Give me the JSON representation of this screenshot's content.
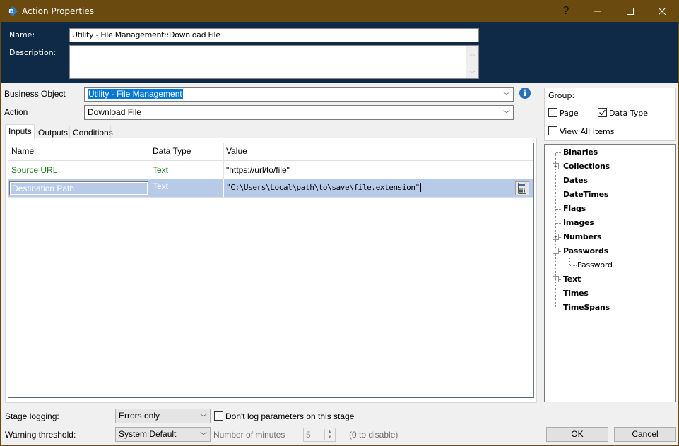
{
  "window": {
    "title": "Action Properties",
    "help_glyph": "?",
    "minimize_glyph": "—",
    "maximize_glyph": "☐",
    "close_glyph": "✕",
    "icon": "blueprism-app-icon"
  },
  "header": {
    "name_label": "Name:",
    "name_value": "Utility - File Management::Download File",
    "description_label": "Description:",
    "description_value": ""
  },
  "form": {
    "business_object_label": "Business Object",
    "business_object_value": "Utility - File Management",
    "action_label": "Action",
    "action_value": "Download File"
  },
  "tabs": [
    {
      "label": "Inputs",
      "active": true
    },
    {
      "label": "Outputs",
      "active": false
    },
    {
      "label": "Conditions",
      "active": false
    }
  ],
  "inputs_grid": {
    "columns": [
      "Name",
      "Data Type",
      "Value"
    ],
    "rows": [
      {
        "name": "Source URL",
        "data_type": "Text",
        "value": "\"https://url/to/file\"",
        "selected": false
      },
      {
        "name": "Destination Path",
        "data_type": "Text",
        "value": "\"C:\\Users\\Local\\path\\to\\save\\file.extension\"",
        "selected": true
      }
    ]
  },
  "group": {
    "label": "Group:",
    "page_label": "Page",
    "page_checked": false,
    "data_type_label": "Data Type",
    "data_type_checked": true,
    "view_all_label": "View All Items",
    "view_all_checked": false
  },
  "tree": {
    "items": [
      {
        "label": "Binaries",
        "expander": ""
      },
      {
        "label": "Collections",
        "expander": "+"
      },
      {
        "label": "Dates",
        "expander": ""
      },
      {
        "label": "DateTimes",
        "expander": ""
      },
      {
        "label": "Flags",
        "expander": ""
      },
      {
        "label": "Images",
        "expander": ""
      },
      {
        "label": "Numbers",
        "expander": "+"
      },
      {
        "label": "Passwords",
        "expander": "−"
      },
      {
        "label": "Password",
        "expander": "",
        "child": true
      },
      {
        "label": "Text",
        "expander": "+"
      },
      {
        "label": "Times",
        "expander": ""
      },
      {
        "label": "TimeSpans",
        "expander": ""
      }
    ]
  },
  "footer": {
    "stage_logging_label": "Stage logging:",
    "stage_logging_value": "Errors only",
    "dont_log_label": "Don't log parameters on this stage",
    "dont_log_checked": false,
    "warning_threshold_label": "Warning threshold:",
    "warning_threshold_value": "System Default",
    "minutes_label": "Number of minutes",
    "minutes_value": "5",
    "disable_hint": "(0 to disable)",
    "ok_label": "OK",
    "cancel_label": "Cancel"
  },
  "colors": {
    "titlebar": "#6b4a10",
    "header": "#0e2a47",
    "selection": "#0078d7",
    "selected_row": "#b7cbe8",
    "green_text": "#1e7a1e",
    "info_icon": "#2b6fb6"
  }
}
